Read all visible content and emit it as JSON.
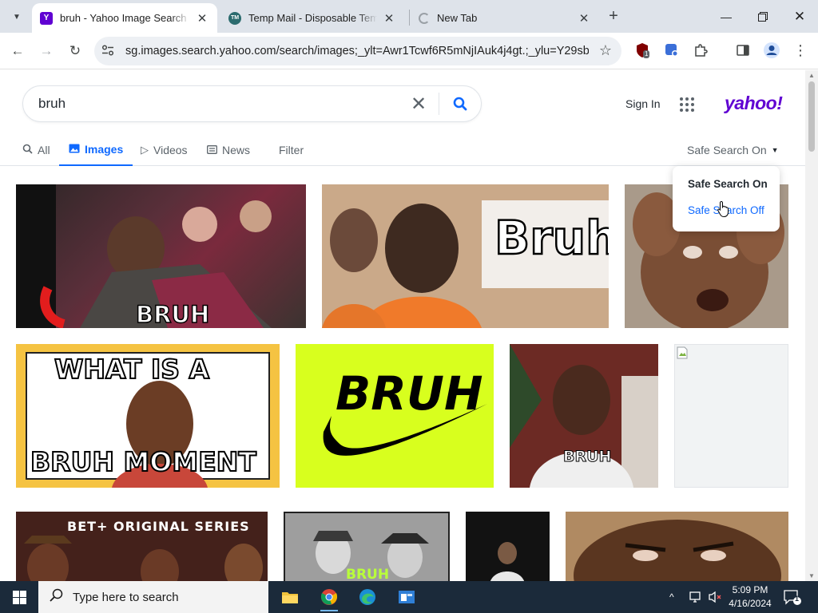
{
  "browser": {
    "tabs": [
      {
        "title": "bruh - Yahoo Image Search res",
        "favicon": "yahoo-y",
        "active": true
      },
      {
        "title": "Temp Mail - Disposable Tempor",
        "favicon": "tempmail",
        "active": false
      },
      {
        "title": "New Tab",
        "favicon": "loading",
        "active": false
      }
    ],
    "url": "sg.images.search.yahoo.com/search/images;_ylt=Awr1Tcwf6R5mNjIAuk4j4gt.;_ylu=Y29sbwN...",
    "extension_badge": "1"
  },
  "yahoo": {
    "query": "bruh",
    "sign_in": "Sign In",
    "logo": "yahoo!",
    "nav": [
      {
        "label": "All",
        "icon": "search-icon"
      },
      {
        "label": "Images",
        "icon": "image-icon",
        "active": true
      },
      {
        "label": "Videos",
        "icon": "play-icon"
      },
      {
        "label": "News",
        "icon": "news-icon"
      },
      {
        "label": "Filter",
        "icon": ""
      }
    ],
    "safe_search": {
      "current": "Safe Search On",
      "options": [
        "Safe Search On",
        "Safe Search Off"
      ]
    },
    "accent_color": "#0f69ff",
    "brand_color": "#6001d2"
  },
  "results": {
    "captions": [
      "BRUH",
      "Bruh",
      "WHAT IS A",
      "BRUH MOMENT",
      "BRUH",
      "BRUH",
      "BET+ ORIGINAL SERIES",
      "BRUH"
    ]
  },
  "taskbar": {
    "search_placeholder": "Type here to search",
    "time": "5:09 PM",
    "date": "4/16/2024",
    "notification_count": "1"
  }
}
